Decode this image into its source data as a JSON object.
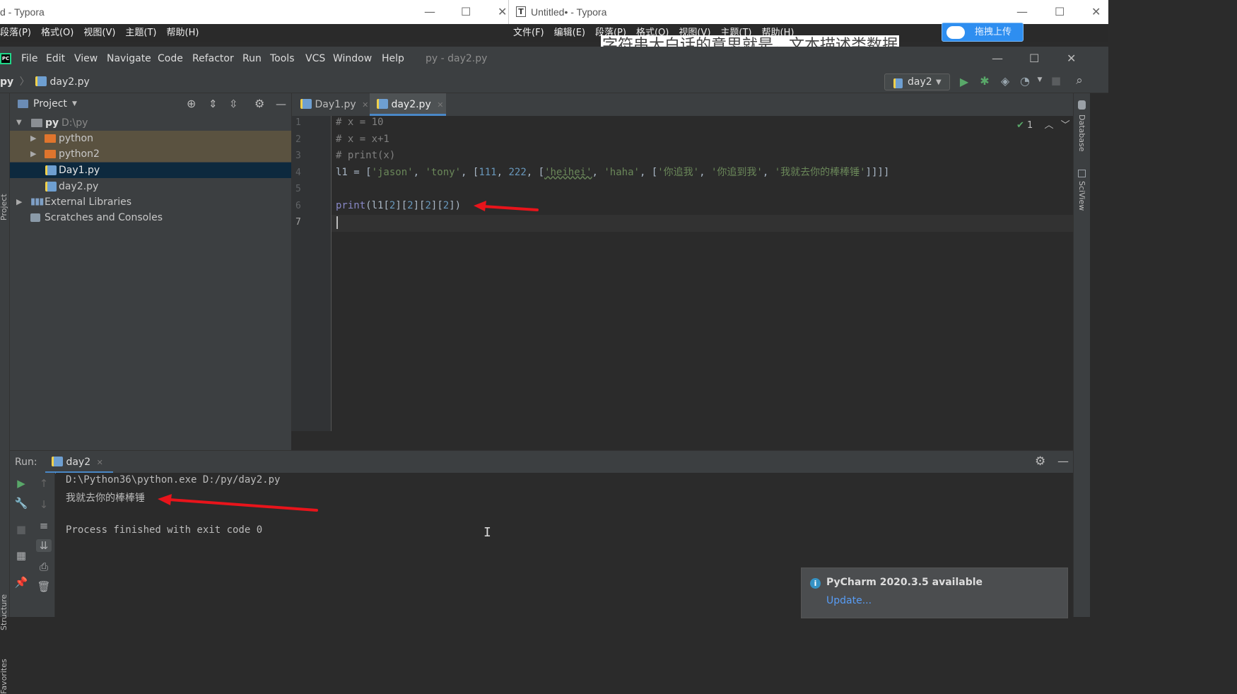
{
  "typora_left": {
    "title": "d - Typora",
    "menu": [
      "段落(P)",
      "格式(O)",
      "视图(V)",
      "主题(T)",
      "帮助(H)"
    ]
  },
  "typora_right": {
    "title": "Untitled• - Typora",
    "menu": [
      "文件(F)",
      "编辑(E)",
      "段落(P)",
      "格式(O)",
      "视图(V)",
      "主题(T)",
      "帮助(H)"
    ],
    "upload_button": "拖拽上传",
    "behind_text": "字符串大白话的意思就是，文本描述类数据"
  },
  "pycharm": {
    "menu": [
      "File",
      "Edit",
      "View",
      "Navigate",
      "Code",
      "Refactor",
      "Run",
      "Tools",
      "VCS",
      "Window",
      "Help"
    ],
    "window_title": "py - day2.py",
    "breadcrumb": {
      "root": "py",
      "file": "day2.py"
    },
    "run_config": "day2",
    "project_panel": {
      "header": "Project",
      "root_name": "py",
      "root_path": "D:\\py",
      "items": [
        "python",
        "python2",
        "Day1.py",
        "day2.py",
        "External Libraries",
        "Scratches and Consoles"
      ]
    },
    "tabs": [
      "Day1.py",
      "day2.py"
    ],
    "inspection_count": "1",
    "line_numbers": [
      "1",
      "2",
      "3",
      "4",
      "5",
      "6",
      "7"
    ],
    "code": {
      "l1": "# x = 10",
      "l2": "# x = x+1",
      "l3": "# print(x)",
      "l4_prefix": "l1 = [",
      "l4_s1": "'jason'",
      "l4_s2": "'tony'",
      "l4_n1": "111",
      "l4_n2": "222",
      "l4_s3": "'heihei'",
      "l4_s4": "'haha'",
      "l4_s5": "'你追我'",
      "l4_s6": "'你追到我'",
      "l4_s7": "'我就去你的棒棒锤'",
      "l4_suffix": "]]]]",
      "l6_fn": "print",
      "l6_a": "(l1[",
      "l6_b": "][",
      "l6_c": "])",
      "l6_index": "2"
    },
    "run_panel": {
      "label": "Run:",
      "tab": "day2",
      "lines": [
        "D:\\Python36\\python.exe D:/py/day2.py",
        "我就去你的棒棒锤",
        "Process finished with exit code 0"
      ]
    },
    "side_labels": {
      "project": "Project",
      "structure": "Structure",
      "favorites": "Favorites",
      "database": "Database",
      "sciview": "SciView"
    },
    "notification": {
      "title": "PyCharm 2020.3.5 available",
      "link": "Update..."
    }
  },
  "colors": {
    "arrow": "#e8141b",
    "accent": "#4a88c7"
  }
}
